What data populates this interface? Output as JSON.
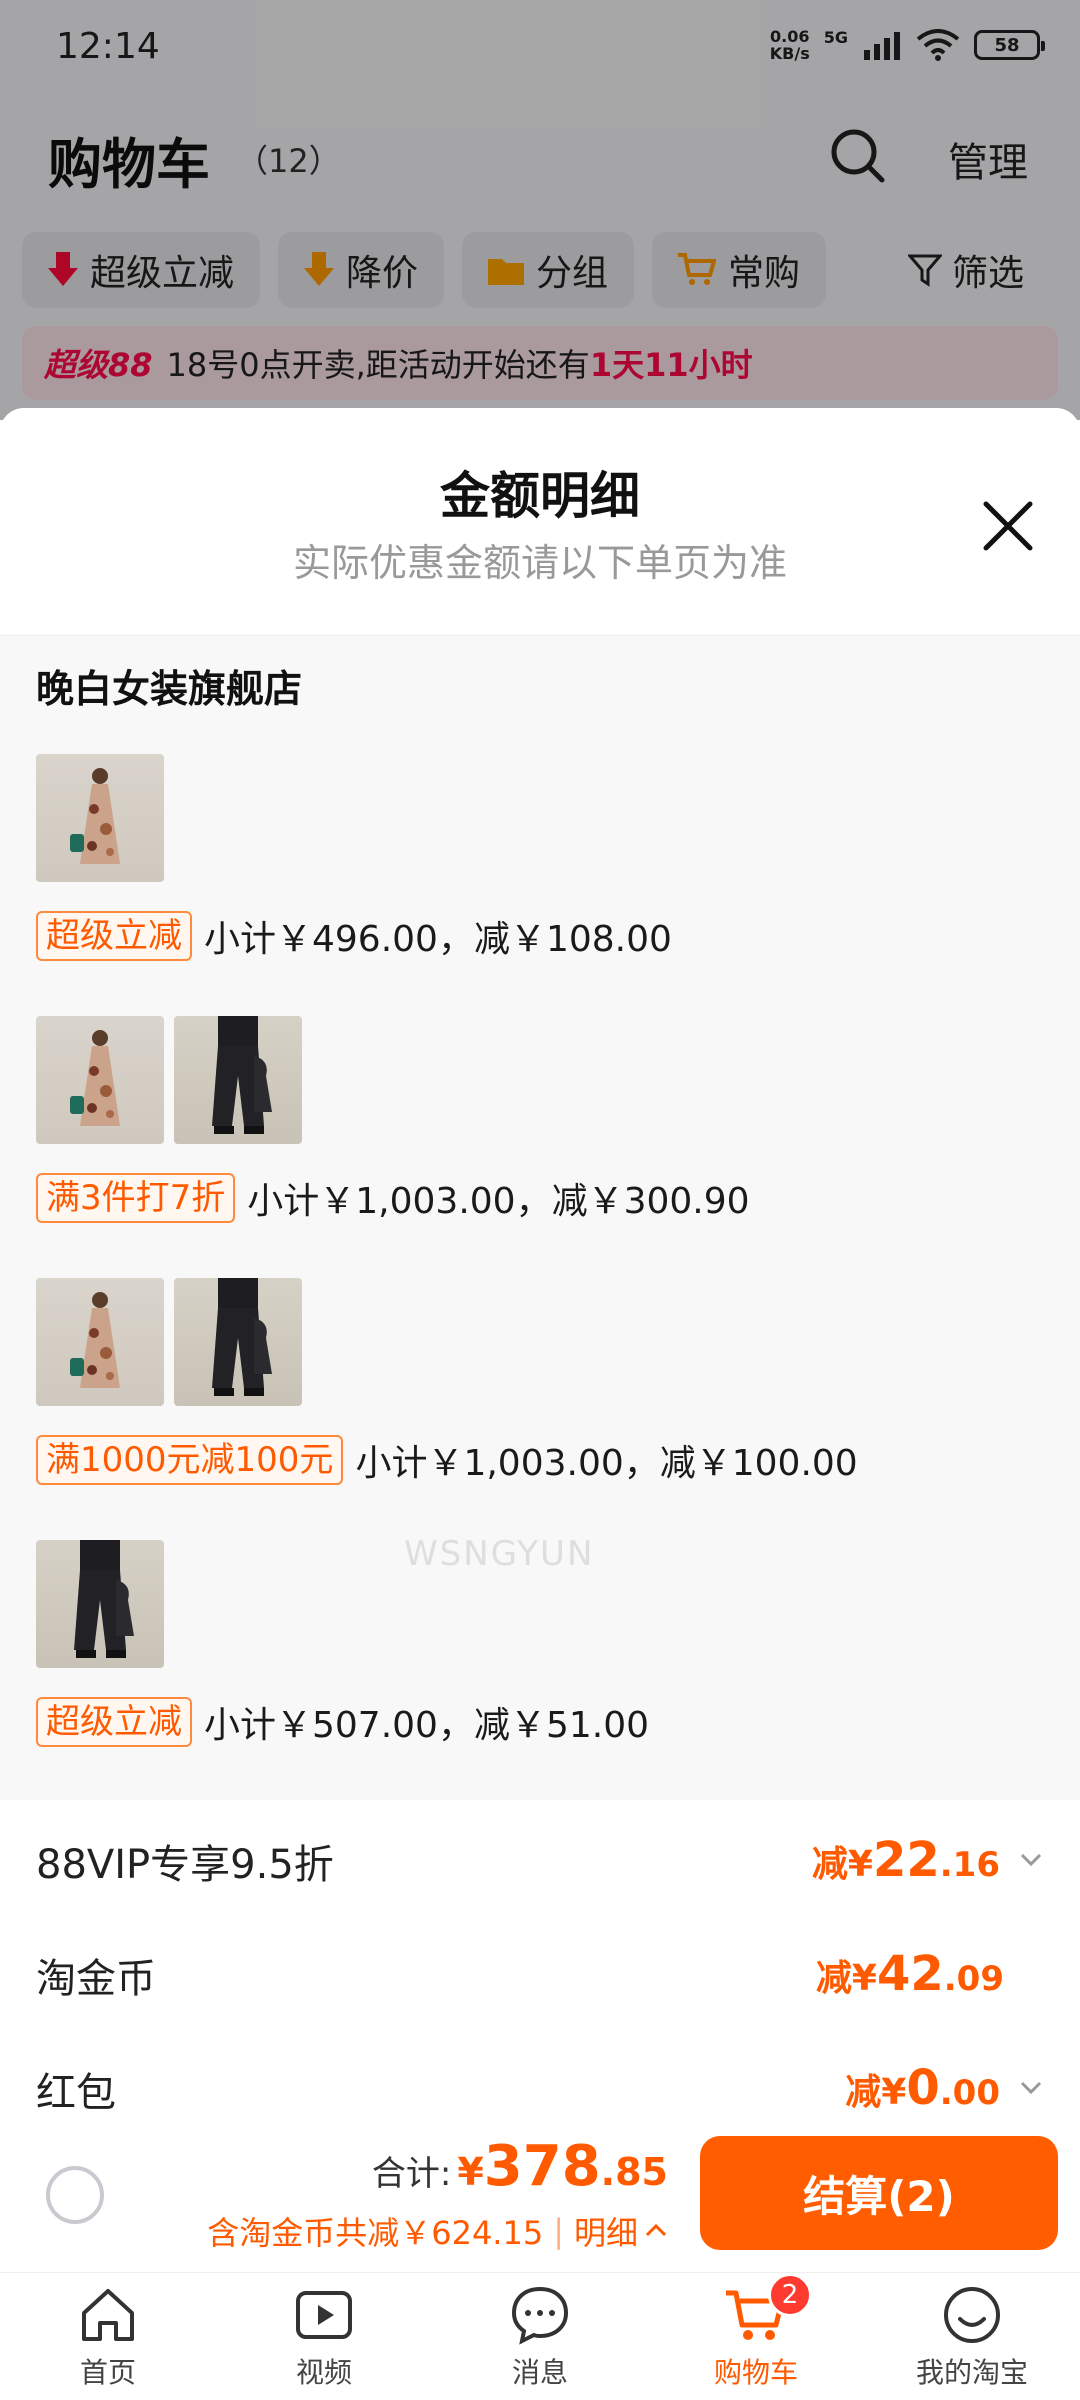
{
  "status_bar": {
    "time": "12:14",
    "net_speed": "0.06",
    "net_unit": "KB/s",
    "network": "5G",
    "battery": "58"
  },
  "cart": {
    "title": "购物车",
    "count": "（12）",
    "manage_label": "管理",
    "filters": [
      "超级立减",
      "降价",
      "分组",
      "常购"
    ],
    "filter_label": "筛选",
    "promo": {
      "brand": "超级88",
      "text": "18号0点开卖,距活动开始还有",
      "countdown": "1天11小时"
    }
  },
  "sheet": {
    "title": "金额明细",
    "subtitle": "实际优惠金额请以下单页为准",
    "store": "晚白女装旗舰店",
    "groups": [
      {
        "tag": "超级立减",
        "subtotal": "小计￥496.00，减￥108.00"
      },
      {
        "tag": "满3件打7折",
        "subtotal": "小计￥1,003.00，减￥300.90"
      },
      {
        "tag": "满1000元减100元",
        "subtotal": "小计￥1,003.00，减￥100.00"
      },
      {
        "tag": "超级立减",
        "subtotal": "小计￥507.00，减￥51.00"
      }
    ],
    "watermark": "WSNGYUN",
    "discounts": [
      {
        "label": "88VIP专享9.5折",
        "prefix": "减¥",
        "int": "22",
        "dec": ".16"
      },
      {
        "label": "淘金币",
        "prefix": "减¥",
        "int": "42",
        "dec": ".09"
      },
      {
        "label": "红包",
        "prefix": "减¥",
        "int": "0",
        "dec": ".00"
      }
    ]
  },
  "checkout": {
    "total_label": "合计:",
    "total_prefix": "¥",
    "total_int": "378",
    "total_dec": ".85",
    "saving": "含淘金币共减￥624.15",
    "detail_label": "明细",
    "button": "结算(2)"
  },
  "nav": {
    "items": [
      {
        "label": "首页",
        "icon": "home-icon"
      },
      {
        "label": "视频",
        "icon": "video-icon"
      },
      {
        "label": "消息",
        "icon": "message-icon"
      },
      {
        "label": "购物车",
        "icon": "cart-icon",
        "badge": "2",
        "active": true
      },
      {
        "label": "我的淘宝",
        "icon": "profile-icon"
      }
    ]
  },
  "colors": {
    "accent": "#ff5a00",
    "promo": "#ff0a4a",
    "checkout_button": "#ff5d00"
  }
}
